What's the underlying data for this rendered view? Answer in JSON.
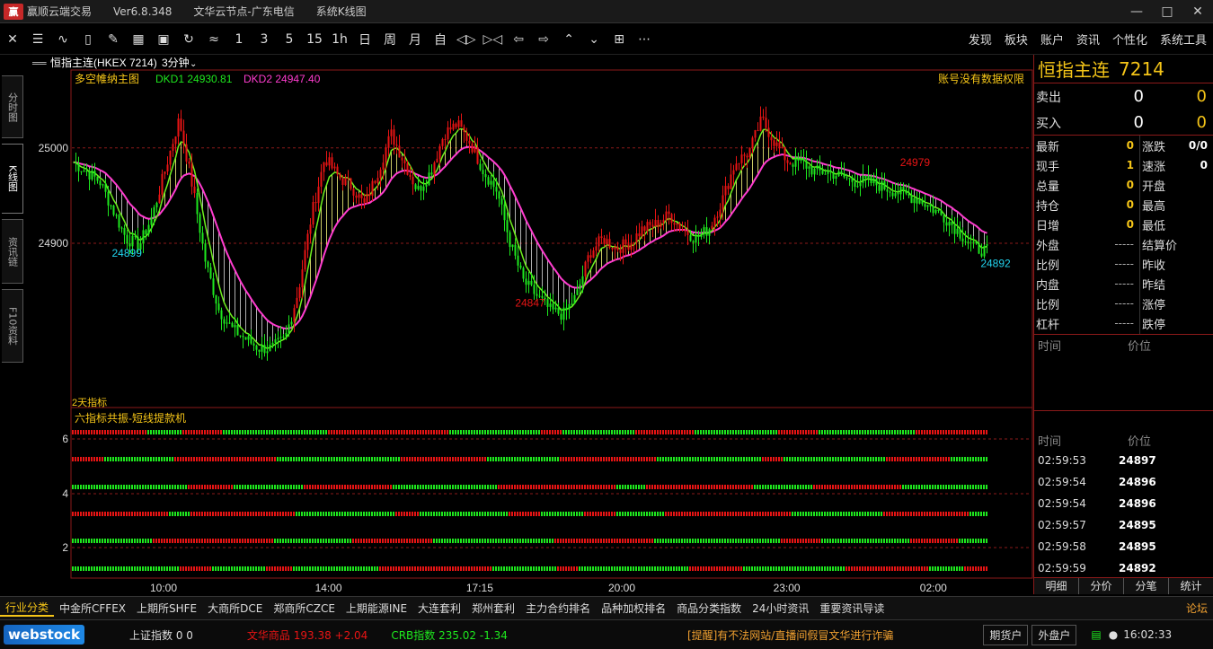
{
  "app": {
    "logo_text": "赢",
    "title": "赢顺云端交易",
    "version": "Ver6.8.348",
    "node": "文华云节点-广东电信",
    "sys_kline": "系统K线图"
  },
  "toolbar": {
    "periods": [
      "1",
      "3",
      "5",
      "15",
      "1h",
      "日",
      "周",
      "月",
      "自"
    ],
    "right_menu": [
      "发现",
      "板块",
      "账户",
      "资讯",
      "个性化",
      "系统工具"
    ]
  },
  "left_tabs": [
    "分时图",
    "K线图",
    "资讯链",
    "F10资料"
  ],
  "chart_header": {
    "contract": "恒指主连(HKEX 7214)",
    "period": "3分钟"
  },
  "main_panel": {
    "indicator": "多空帷纳主图",
    "dkd1_label": "DKD1 24930.81",
    "dkd2_label": "DKD2 24947.40",
    "no_permission": "账号没有数据权限",
    "sub_caption": "2天指标",
    "colors": {
      "up": "#e81414",
      "down": "#1ee81e",
      "band_upper": "#ff3ccf",
      "band_lower": "#6ef01e",
      "fill": "#ffff80"
    }
  },
  "sub_panel": {
    "indicator": "六指标共振-短线提款机"
  },
  "chart_data": {
    "type": "candlestick",
    "y_ticks": [
      25000,
      24900
    ],
    "y_range": [
      24740,
      25060
    ],
    "x_labels": [
      "10:00",
      "14:00",
      "17:15",
      "20:00",
      "23:00",
      "02:00"
    ],
    "annotations": [
      {
        "text": "24899"
      },
      {
        "text": "24847"
      },
      {
        "text": "24979"
      },
      {
        "text": "24892"
      }
    ],
    "price_path": [
      24985,
      24975,
      24965,
      24935,
      24905,
      24898,
      24930,
      24980,
      25030,
      24960,
      24880,
      24830,
      24810,
      24800,
      24790,
      24790,
      24800,
      24850,
      24930,
      24990,
      24970,
      24960,
      24940,
      24975,
      25015,
      24985,
      24955,
      24975,
      25015,
      25025,
      25005,
      24975,
      24955,
      24900,
      24860,
      24845,
      24830,
      24825,
      24845,
      24890,
      24905,
      24895,
      24900,
      24915,
      24920,
      24930,
      24915,
      24905,
      24915,
      24945,
      24985,
      24995,
      25030,
      25005,
      24985,
      24985,
      24975,
      24975,
      24970,
      24965,
      24965,
      24960,
      24955,
      24950,
      24945,
      24935,
      24925,
      24910,
      24895,
      24892
    ],
    "sub_panel_y_ticks": [
      6,
      4,
      2
    ],
    "sub_panel_rows": 6
  },
  "quote": {
    "title": "恒指主连",
    "code": "7214",
    "sell": {
      "label": "卖出",
      "v1": "0",
      "v2": "0"
    },
    "buy": {
      "label": "买入",
      "v1": "0",
      "v2": "0"
    },
    "left": [
      {
        "l": "最新",
        "v": "0"
      },
      {
        "l": "现手",
        "v": "1"
      },
      {
        "l": "总量",
        "v": "0"
      },
      {
        "l": "持仓",
        "v": "0"
      },
      {
        "l": "日增",
        "v": "0"
      },
      {
        "l": "外盘",
        "v": "-----"
      },
      {
        "l": "比例",
        "v": "-----"
      },
      {
        "l": "内盘",
        "v": "-----"
      },
      {
        "l": "比例",
        "v": "-----"
      },
      {
        "l": "杠杆",
        "v": "-----"
      }
    ],
    "right": [
      {
        "l": "涨跌",
        "v": "0/0"
      },
      {
        "l": "速涨",
        "v": "0"
      },
      {
        "l": "开盘",
        "v": ""
      },
      {
        "l": "最高",
        "v": ""
      },
      {
        "l": "最低",
        "v": ""
      },
      {
        "l": "结算价",
        "v": ""
      },
      {
        "l": "昨收",
        "v": ""
      },
      {
        "l": "昨结",
        "v": ""
      },
      {
        "l": "涨停",
        "v": ""
      },
      {
        "l": "跌停",
        "v": ""
      }
    ]
  },
  "time_header": {
    "time": "时间",
    "price": "价位"
  },
  "ticks": [
    {
      "t": "02:59:53",
      "p": "24897"
    },
    {
      "t": "02:59:54",
      "p": "24896"
    },
    {
      "t": "02:59:54",
      "p": "24896"
    },
    {
      "t": "02:59:57",
      "p": "24895"
    },
    {
      "t": "02:59:58",
      "p": "24895"
    },
    {
      "t": "02:59:59",
      "p": "24892"
    }
  ],
  "right_tabs": [
    "明细",
    "分价",
    "分笔",
    "统计"
  ],
  "menubar": [
    "行业分类",
    "中金所CFFEX",
    "上期所SHFE",
    "大商所DCE",
    "郑商所CZCE",
    "上期能源INE",
    "大连套利",
    "郑州套利",
    "主力合约排名",
    "品种加权排名",
    "商品分类指数",
    "24小时资讯",
    "重要资讯导读"
  ],
  "forum": "论坛",
  "status": {
    "logo": "webstock",
    "sh_index": "上证指数  0  0",
    "wenhua": "文华商品  193.38 +2.04",
    "crb": "CRB指数   235.02 -1.34",
    "notice": "[提醒]有不法网站/直播间假冒文华进行诈骗",
    "btn_futures": "期货户",
    "btn_outer": "外盘户",
    "clock": "16:02:33"
  }
}
